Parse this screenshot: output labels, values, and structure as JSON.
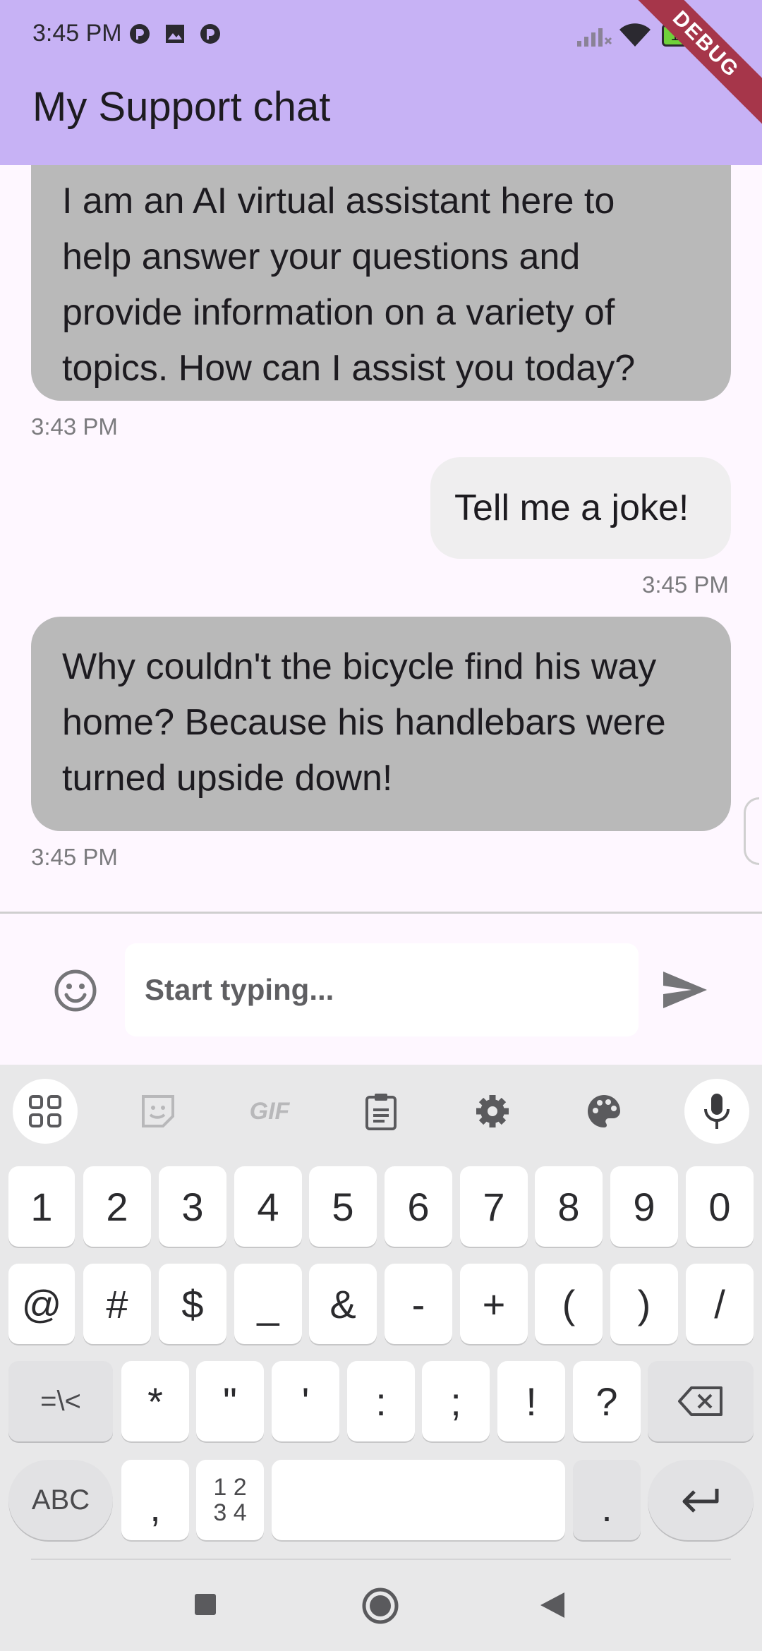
{
  "status_bar": {
    "time": "3:45 PM",
    "battery": "100"
  },
  "app_bar": {
    "title": "My Support chat",
    "debug_banner": "DEBUG"
  },
  "messages": [
    {
      "from": "bot",
      "text_lines": [
        "I am an AI virtual assistant here to",
        "help answer your questions and",
        "provide information on a variety of",
        "topics. How can I assist you today?"
      ],
      "time": "3:43 PM"
    },
    {
      "from": "user",
      "text_lines": [
        "Tell me a joke!"
      ],
      "time": "3:45 PM"
    },
    {
      "from": "bot",
      "text_lines": [
        "Why couldn't the bicycle find his way",
        "home? Because his handlebars were",
        "turned upside down!"
      ],
      "time": "3:45 PM"
    }
  ],
  "input": {
    "placeholder": "Start typing...",
    "value": ""
  },
  "keyboard": {
    "tools": [
      "apps-grid-icon",
      "sticker-icon",
      "gif-icon",
      "clipboard-icon",
      "settings-icon",
      "palette-icon",
      "mic-icon"
    ],
    "gif_label": "GIF",
    "row1": [
      "1",
      "2",
      "3",
      "4",
      "5",
      "6",
      "7",
      "8",
      "9",
      "0"
    ],
    "row2": [
      "@",
      "#",
      "$",
      "_",
      "&",
      "-",
      "+",
      "(",
      ")",
      "/"
    ],
    "row3": [
      "=\\<",
      "*",
      "\"",
      "'",
      ":",
      ";",
      "!",
      "?"
    ],
    "abc_label": "ABC",
    "comma": ",",
    "numpad_label_top": "1 2",
    "numpad_label_bottom": "3 4",
    "period": "."
  },
  "colors": {
    "app_bar": "#c7b2f5",
    "bot_bubble": "#b9b9b9",
    "user_bubble": "#efeeef",
    "background": "#fef7ff",
    "debug_ribbon": "#a6364a"
  }
}
